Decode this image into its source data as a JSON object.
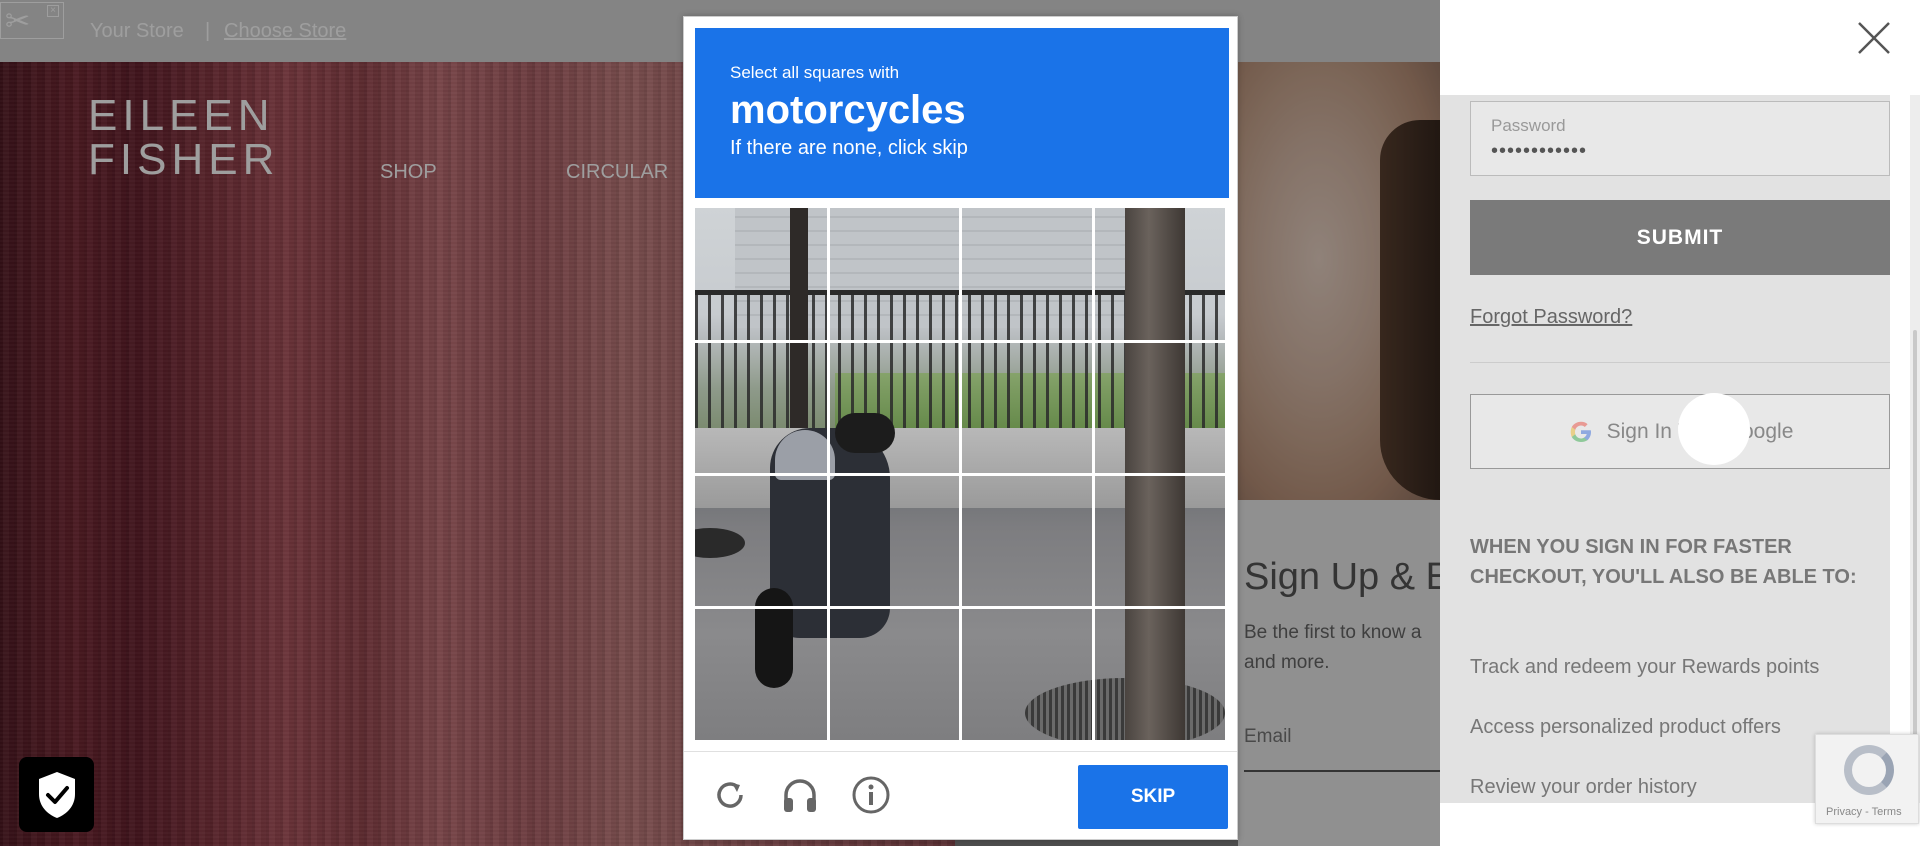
{
  "topbar": {
    "your_store": "Your Store",
    "separator": "|",
    "choose_store": "Choose Store"
  },
  "brand": {
    "logo_line1": "EILEEN",
    "logo_line2": "FISHER"
  },
  "nav": {
    "shop": "SHOP",
    "circular": "CIRCULAR"
  },
  "signup": {
    "title": "Sign Up & E",
    "body": "Be the first to know a and more.",
    "email_label": "Email"
  },
  "captcha": {
    "line1": "Select all squares with",
    "line2": "motorcycles",
    "line3": "If there are none, click skip",
    "grid": {
      "rows": 4,
      "cols": 4
    },
    "skip_label": "SKIP",
    "icons": [
      "refresh-icon",
      "headphones-icon",
      "info-icon"
    ],
    "accent_color": "#1a73e8"
  },
  "login": {
    "password_label": "Password",
    "password_value": "••••••••••••",
    "submit_label": "SUBMIT",
    "forgot_label": "Forgot Password?",
    "google_label": "Sign In With Google"
  },
  "benefits": {
    "heading": "WHEN YOU SIGN IN FOR FASTER CHECKOUT, YOU'LL ALSO BE ABLE TO:",
    "items": [
      "Track and redeem your Rewards points",
      "Access personalized product offers",
      "Review your order history"
    ]
  },
  "recaptcha": {
    "privacy": "Privacy",
    "separator": " - ",
    "terms": "Terms"
  },
  "icons": {
    "tools": "tools-icon",
    "close": "close-icon",
    "shield": "shield-check-icon",
    "google": "google-icon"
  }
}
